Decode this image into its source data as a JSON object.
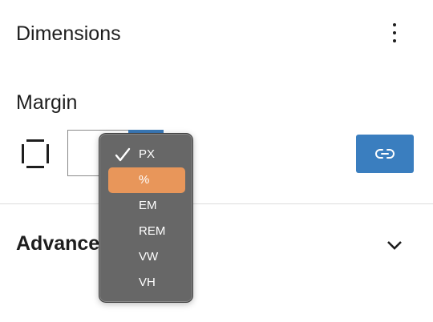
{
  "panel": {
    "title": "Dimensions"
  },
  "margin": {
    "label": "Margin",
    "value": ""
  },
  "advanced": {
    "label": "Advanced"
  },
  "units": {
    "checked": "PX",
    "highlighted": "%",
    "options": [
      "PX",
      "%",
      "EM",
      "REM",
      "VW",
      "VH"
    ]
  },
  "colors": {
    "accent": "#3a7ebf",
    "highlight": "#e8965a",
    "menu_bg": "#676767"
  },
  "icons": {
    "more": "more-vertical-icon",
    "sides": "box-sides-icon",
    "link": "link-icon",
    "chevron": "chevron-down-icon",
    "check": "check-icon"
  }
}
